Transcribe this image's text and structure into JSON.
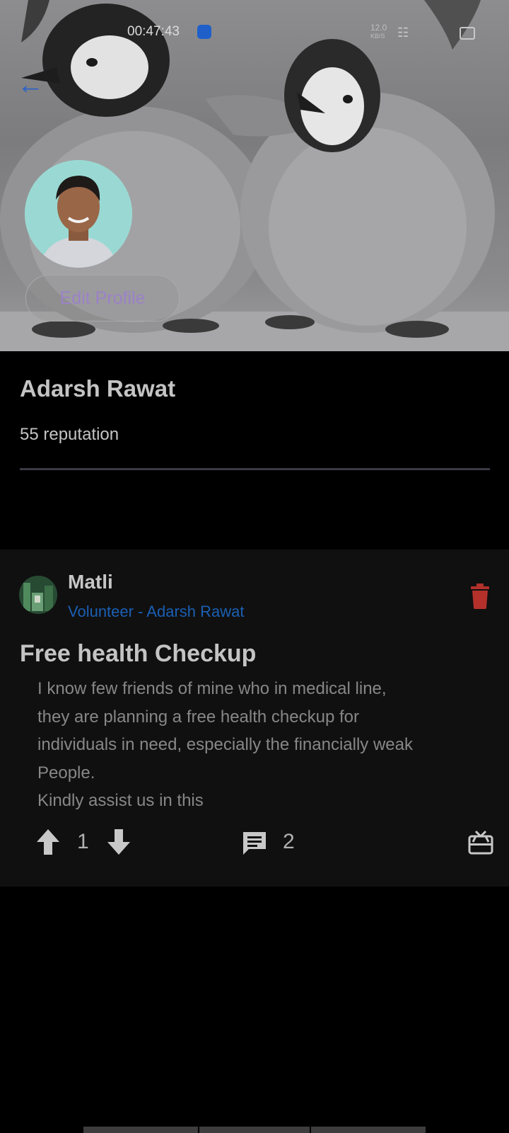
{
  "status_bar": {
    "time": "00:47:43",
    "net_speed": "12.0",
    "net_unit": "KB/S"
  },
  "profile": {
    "name": "Adarsh Rawat",
    "reputation": "55 reputation",
    "edit_label": "Edit Profile"
  },
  "post": {
    "author": "Matli",
    "role": "Volunteer - Adarsh Rawat",
    "title": "Free health Checkup",
    "body_lines": [
      "I know few friends of mine who in medical line,",
      "they are planning a free health checkup for",
      "individuals in need, especially the financially weak",
      "People.",
      "Kindly assist us in this"
    ],
    "votes": "1",
    "comments": "2"
  },
  "icons": {
    "back": "arrow-back-icon",
    "delete": "trash-icon",
    "upvote": "arrow-up-icon",
    "downvote": "arrow-down-icon",
    "comment": "comment-icon",
    "gift": "gift-card-icon"
  },
  "colors": {
    "accent_link": "#1b5fb3",
    "edit_text": "#9b82c7",
    "delete": "#b3302b",
    "card_bg": "#101010"
  }
}
